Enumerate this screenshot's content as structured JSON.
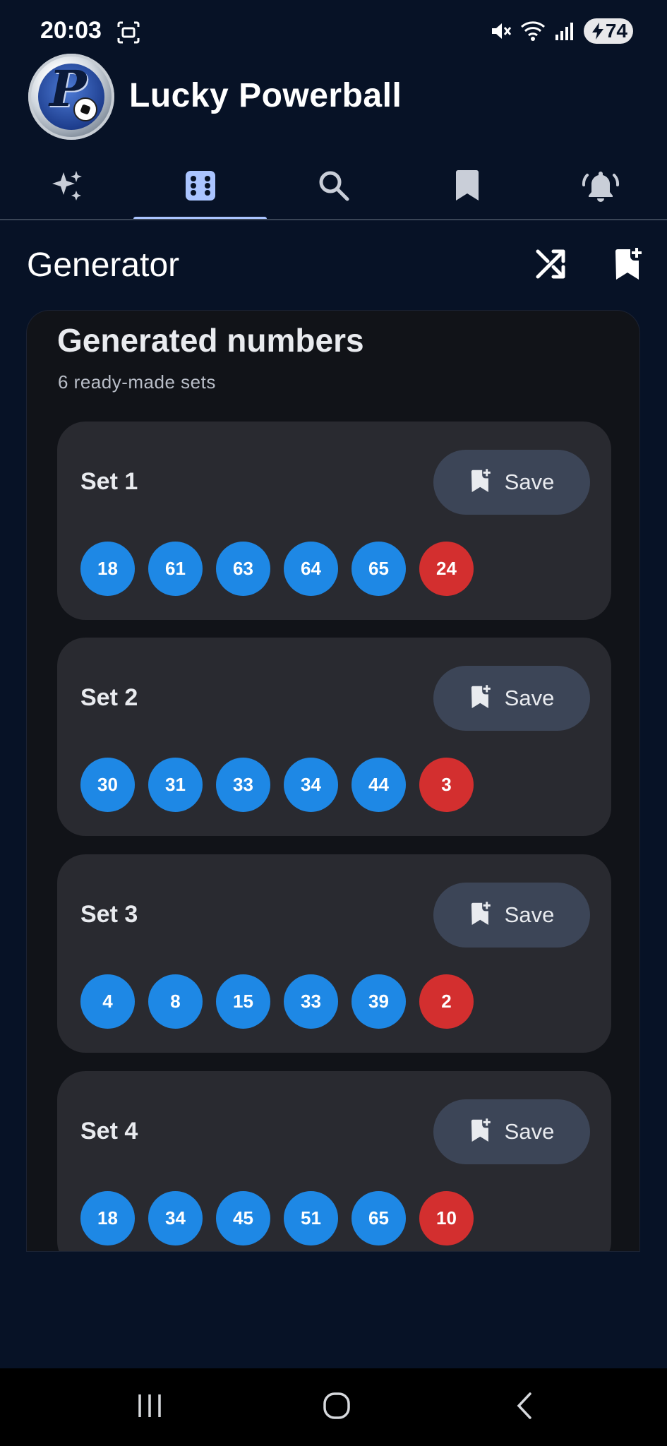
{
  "status_bar": {
    "time": "20:03",
    "battery": "74"
  },
  "app": {
    "title": "Lucky Powerball"
  },
  "tabs": [
    {
      "name": "sparkle-icon"
    },
    {
      "name": "dice-icon",
      "selected": true
    },
    {
      "name": "search-icon"
    },
    {
      "name": "bookmark-icon"
    },
    {
      "name": "bell-icon"
    }
  ],
  "toolbar": {
    "title": "Generator",
    "actions": [
      "shuffle-icon",
      "bookmark-add-icon"
    ]
  },
  "generated": {
    "title": "Generated numbers",
    "subtitle": "6 ready-made sets"
  },
  "sets": [
    {
      "label": "Set 1",
      "save": "Save",
      "numbers": [
        "18",
        "61",
        "63",
        "64",
        "65"
      ],
      "powerball": "24"
    },
    {
      "label": "Set 2",
      "save": "Save",
      "numbers": [
        "30",
        "31",
        "33",
        "34",
        "44"
      ],
      "powerball": "3"
    },
    {
      "label": "Set 3",
      "save": "Save",
      "numbers": [
        "4",
        "8",
        "15",
        "33",
        "39"
      ],
      "powerball": "2"
    },
    {
      "label": "Set 4",
      "save": "Save",
      "numbers": [
        "18",
        "34",
        "45",
        "51",
        "65"
      ],
      "powerball": "10"
    }
  ],
  "colors": {
    "background": "#071226",
    "card": "#111318",
    "set_card": "#292a30",
    "white_ball": "#1e88e5",
    "power_ball": "#d32f2f",
    "accent": "#aac4ff"
  }
}
